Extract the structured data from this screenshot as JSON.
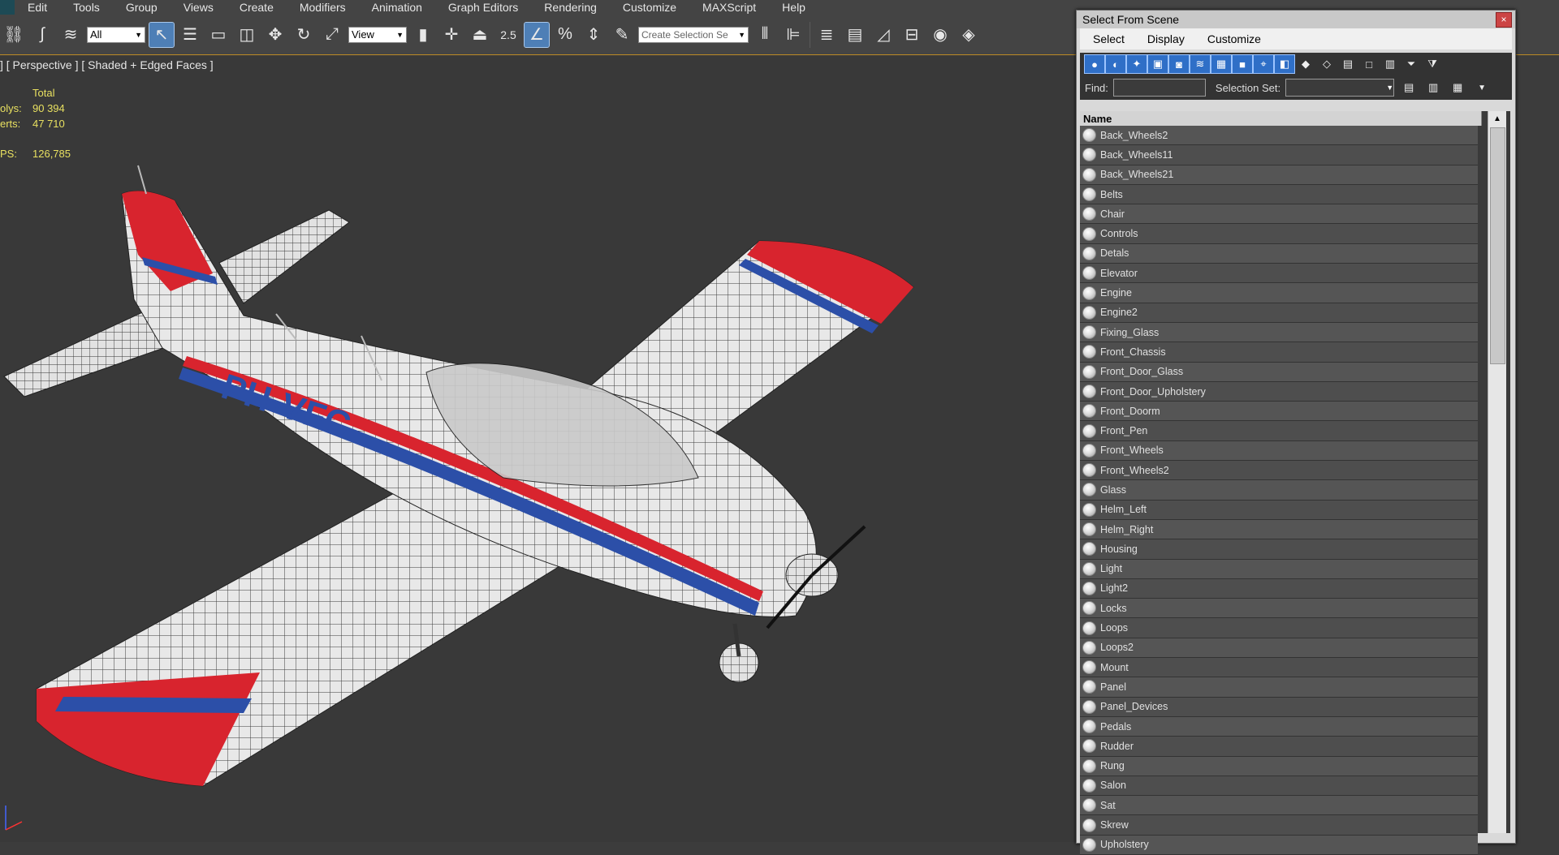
{
  "menu": [
    "Edit",
    "Tools",
    "Group",
    "Views",
    "Create",
    "Modifiers",
    "Animation",
    "Graph Editors",
    "Rendering",
    "Customize",
    "MAXScript",
    "Help"
  ],
  "toolbar": {
    "filter_value": "All",
    "coord_value": "View",
    "snap_label": "2.5",
    "selection_set_placeholder": "Create Selection Se"
  },
  "viewport": {
    "label": "] [ Perspective ] [ Shaded + Edged Faces ]",
    "stats_header": "Total",
    "stats": [
      {
        "key": "olys:",
        "value": "90 394"
      },
      {
        "key": "erts:",
        "value": "47 710"
      }
    ],
    "fps_key": "PS:",
    "fps_value": "126,785",
    "registration": "PH-VFC",
    "colors": {
      "red": "#d8242e",
      "blue": "#2c4fa8",
      "white": "#e9e9e9",
      "wire": "#222222"
    }
  },
  "dialog": {
    "title": "Select From Scene",
    "close_label": "×",
    "menu": [
      "Select",
      "Display",
      "Customize"
    ],
    "find_label": "Find:",
    "selection_set_label": "Selection Set:",
    "list_header": "Name",
    "objects": [
      "Back_Wheels2",
      "Back_Wheels11",
      "Back_Wheels21",
      "Belts",
      "Chair",
      "Controls",
      "Detals",
      "Elevator",
      "Engine",
      "Engine2",
      "Fixing_Glass",
      "Front_Chassis",
      "Front_Door_Glass",
      "Front_Door_Upholstery",
      "Front_Doorm",
      "Front_Pen",
      "Front_Wheels",
      "Front_Wheels2",
      "Glass",
      "Helm_Left",
      "Helm_Right",
      "Housing",
      "Light",
      "Light2",
      "Locks",
      "Loops",
      "Loops2",
      "Mount",
      "Panel",
      "Panel_Devices",
      "Pedals",
      "Rudder",
      "Rung",
      "Salon",
      "Sat",
      "Skrew",
      "Upholstery"
    ]
  }
}
